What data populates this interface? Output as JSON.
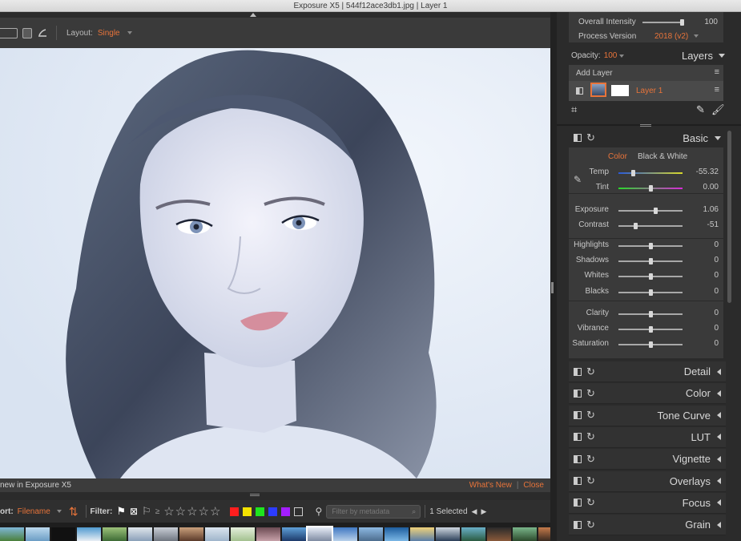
{
  "window": {
    "title": "Exposure X5 | 544f12ace3db1.jpg | Layer 1"
  },
  "toolbar": {
    "layout_label": "Layout:",
    "layout_value": "Single"
  },
  "hint": {
    "text": "new in Exposure X5",
    "whats_new": "What's New",
    "separator": "|",
    "close": "Close"
  },
  "filterbar": {
    "sort_label": "ort:",
    "sort_value": "Filename",
    "filter_label": "Filter:",
    "rating_prefix": "≥",
    "stars": "☆☆☆☆☆",
    "colors": [
      "#ff1e1e",
      "#f4e200",
      "#1ee51e",
      "#2c3cff",
      "#a31eff"
    ],
    "metadata_placeholder": "Filter by metadata",
    "selected": "1 Selected"
  },
  "top_panel": {
    "overall_intensity_label": "Overall Intensity",
    "overall_intensity_value": "100",
    "overall_intensity": 100,
    "process_version_label": "Process Version",
    "process_version_value": "2018 (v2)"
  },
  "layers": {
    "opacity_label": "Opacity:",
    "opacity_value": "100",
    "panel_title": "Layers",
    "add_layer": "Add Layer",
    "layer_name": "Layer 1"
  },
  "basic": {
    "title": "Basic",
    "tab_color": "Color",
    "tab_bw": "Black & White",
    "sliders": [
      {
        "label": "Temp",
        "value": "-55.32",
        "pos": 0.23
      },
      {
        "label": "Tint",
        "value": "0.00",
        "pos": 0.5
      },
      {
        "label": "Exposure",
        "value": "1.06",
        "pos": 0.58
      },
      {
        "label": "Contrast",
        "value": "-51",
        "pos": 0.26
      },
      {
        "label": "Highlights",
        "value": "0",
        "pos": 0.5
      },
      {
        "label": "Shadows",
        "value": "0",
        "pos": 0.5
      },
      {
        "label": "Whites",
        "value": "0",
        "pos": 0.5
      },
      {
        "label": "Blacks",
        "value": "0",
        "pos": 0.5
      },
      {
        "label": "Clarity",
        "value": "0",
        "pos": 0.5
      },
      {
        "label": "Vibrance",
        "value": "0",
        "pos": 0.5
      },
      {
        "label": "Saturation",
        "value": "0",
        "pos": 0.5
      }
    ]
  },
  "sections": [
    "Detail",
    "Color",
    "Tone Curve",
    "LUT",
    "Vignette",
    "Overlays",
    "Focus",
    "Grain"
  ]
}
